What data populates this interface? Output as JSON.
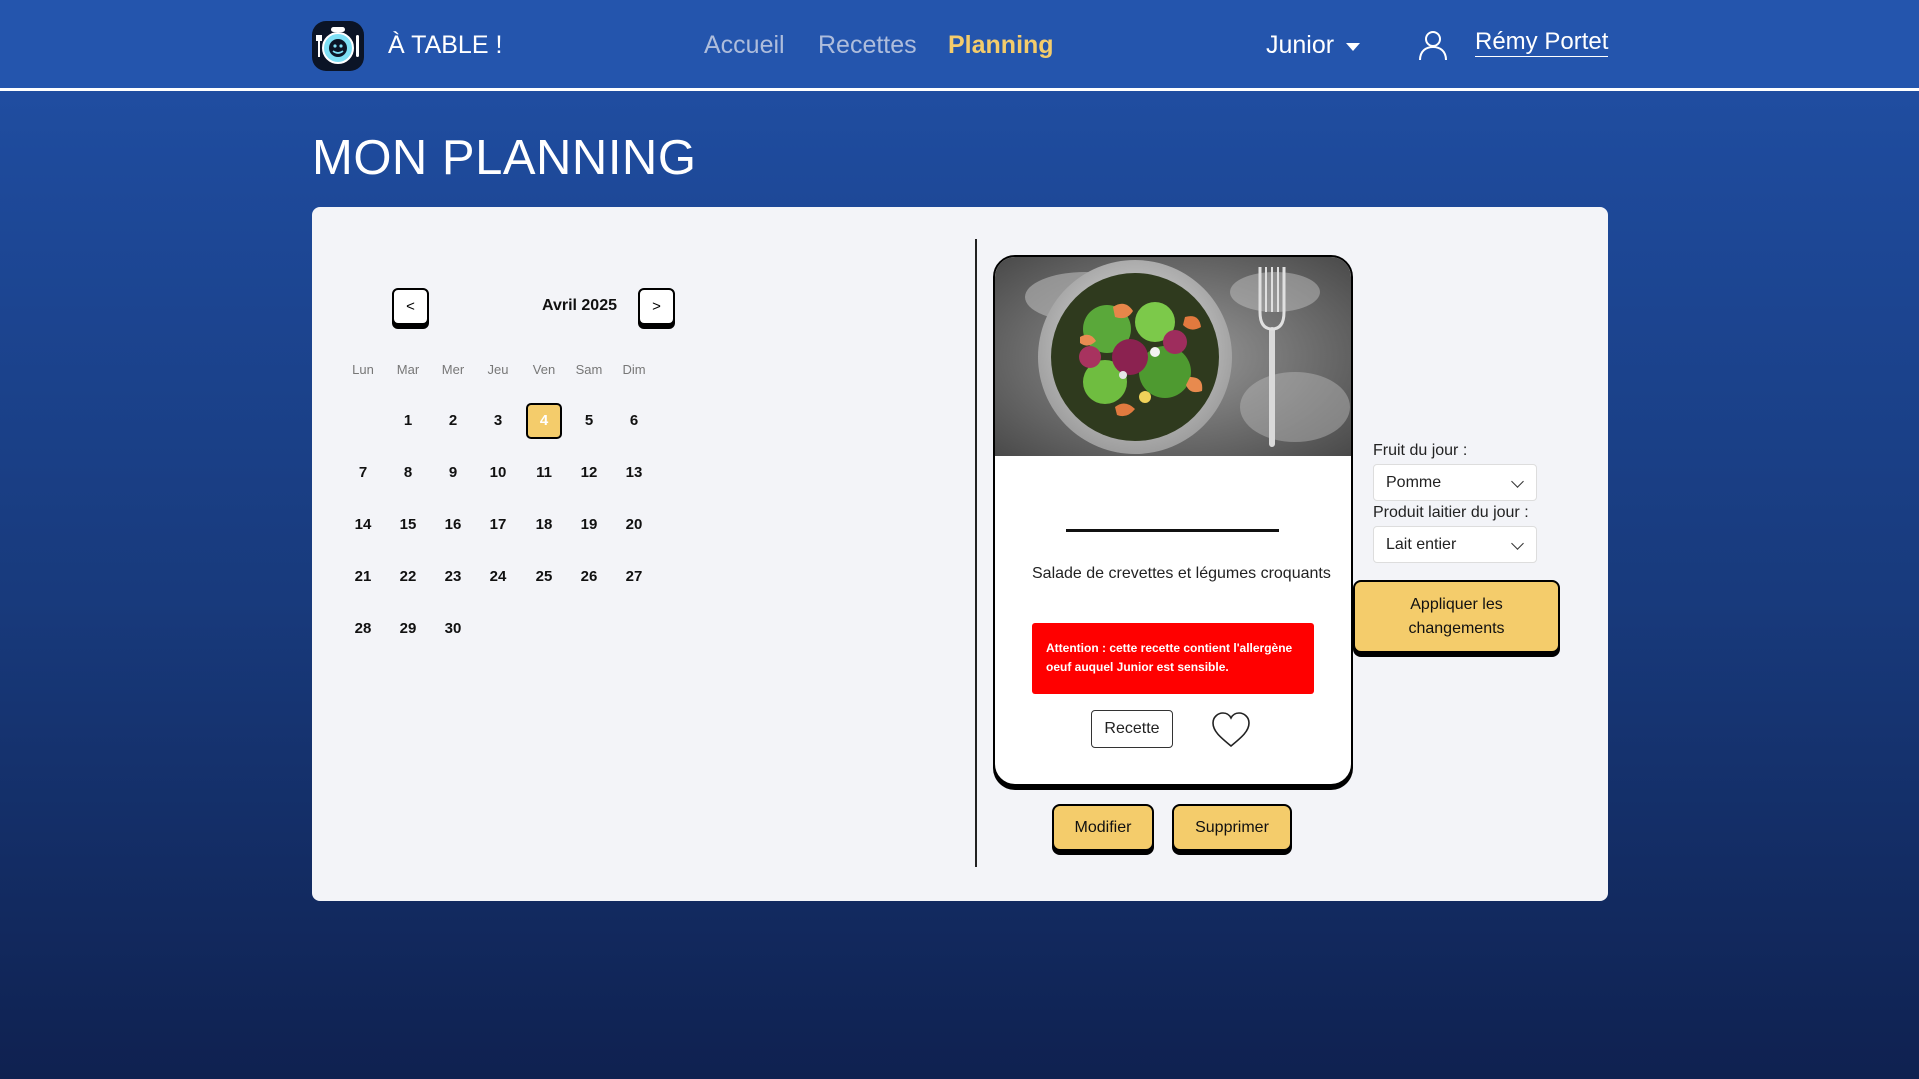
{
  "header": {
    "brand": "À TABLE !",
    "nav": [
      {
        "label": "Accueil",
        "active": false
      },
      {
        "label": "Recettes",
        "active": false
      },
      {
        "label": "Planning",
        "active": true
      }
    ],
    "profile": "Junior",
    "user_name": "Rémy Portet",
    "accent_color": "#f4cc6b"
  },
  "page": {
    "title": "MON PLANNING"
  },
  "calendar": {
    "prev": "<",
    "next": ">",
    "month": "Avril 2025",
    "weekdays": [
      "Lun",
      "Mar",
      "Mer",
      "Jeu",
      "Ven",
      "Sam",
      "Dim"
    ],
    "first_weekday_index": 1,
    "days_in_month": 30,
    "selected_day": 4
  },
  "recipe": {
    "title": "Salade de crevettes et légumes croquants",
    "alert": "Attention : cette recette contient l'allergène oeuf auquel Junior est sensible.",
    "alert_color": "#ff0000",
    "recipe_button": "Recette",
    "favorite_icon": "heart-icon",
    "modify_button": "Modifier",
    "delete_button": "Supprimer"
  },
  "daily": {
    "fruit_label": "Fruit du jour :",
    "fruit_value": "Pomme",
    "dairy_label": "Produit laitier du jour :",
    "dairy_value": "Lait entier",
    "apply_button": "Appliquer les changements"
  }
}
